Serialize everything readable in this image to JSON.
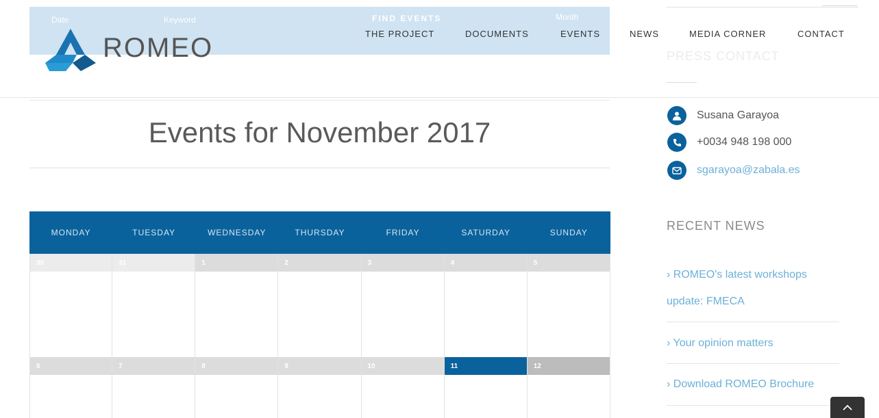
{
  "filter_bar": {
    "date_label": "Date",
    "keyword_label": "Keyword",
    "find_label": "FIND EVENTS",
    "month_label": "Month"
  },
  "brand": {
    "name": "ROMEO",
    "color": "#1a73b0"
  },
  "nav": {
    "items": [
      "THE PROJECT",
      "DOCUMENTS",
      "EVENTS",
      "NEWS",
      "MEDIA CORNER",
      "CONTACT"
    ]
  },
  "page": {
    "title": "Events for November 2017"
  },
  "calendar": {
    "header_color": "#0a629d",
    "days": [
      "MONDAY",
      "TUESDAY",
      "WEDNESDAY",
      "THURSDAY",
      "FRIDAY",
      "SATURDAY",
      "SUNDAY"
    ],
    "week1": [
      "30",
      "31",
      "1",
      "2",
      "3",
      "4",
      "5"
    ],
    "week2": [
      "6",
      "7",
      "8",
      "9",
      "10",
      "11",
      "12"
    ]
  },
  "sidebar": {
    "press_title": "PRESS CONTACT",
    "contact": {
      "name": "Susana Garayoa",
      "phone": "+0034 948 198 000",
      "email": "sgarayoa@zabala.es"
    },
    "recent_title": "RECENT NEWS",
    "news": [
      "ROMEO's latest workshops update: FMECA",
      "Your opinion matters",
      "Download ROMEO Brochure"
    ],
    "news_prefix": "›"
  },
  "icons": {
    "user": "user-icon",
    "phone": "phone-icon",
    "mail": "mail-icon",
    "to_top": "chevron-up-icon"
  }
}
